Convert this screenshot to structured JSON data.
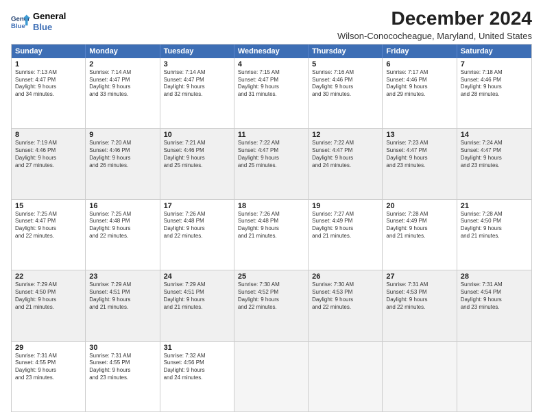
{
  "logo": {
    "line1": "General",
    "line2": "Blue"
  },
  "title": "December 2024",
  "subtitle": "Wilson-Conococheague, Maryland, United States",
  "days": [
    "Sunday",
    "Monday",
    "Tuesday",
    "Wednesday",
    "Thursday",
    "Friday",
    "Saturday"
  ],
  "weeks": [
    [
      {
        "day": "1",
        "info": "Sunrise: 7:13 AM\nSunset: 4:47 PM\nDaylight: 9 hours\nand 34 minutes."
      },
      {
        "day": "2",
        "info": "Sunrise: 7:14 AM\nSunset: 4:47 PM\nDaylight: 9 hours\nand 33 minutes."
      },
      {
        "day": "3",
        "info": "Sunrise: 7:14 AM\nSunset: 4:47 PM\nDaylight: 9 hours\nand 32 minutes."
      },
      {
        "day": "4",
        "info": "Sunrise: 7:15 AM\nSunset: 4:47 PM\nDaylight: 9 hours\nand 31 minutes."
      },
      {
        "day": "5",
        "info": "Sunrise: 7:16 AM\nSunset: 4:46 PM\nDaylight: 9 hours\nand 30 minutes."
      },
      {
        "day": "6",
        "info": "Sunrise: 7:17 AM\nSunset: 4:46 PM\nDaylight: 9 hours\nand 29 minutes."
      },
      {
        "day": "7",
        "info": "Sunrise: 7:18 AM\nSunset: 4:46 PM\nDaylight: 9 hours\nand 28 minutes."
      }
    ],
    [
      {
        "day": "8",
        "info": "Sunrise: 7:19 AM\nSunset: 4:46 PM\nDaylight: 9 hours\nand 27 minutes."
      },
      {
        "day": "9",
        "info": "Sunrise: 7:20 AM\nSunset: 4:46 PM\nDaylight: 9 hours\nand 26 minutes."
      },
      {
        "day": "10",
        "info": "Sunrise: 7:21 AM\nSunset: 4:46 PM\nDaylight: 9 hours\nand 25 minutes."
      },
      {
        "day": "11",
        "info": "Sunrise: 7:22 AM\nSunset: 4:47 PM\nDaylight: 9 hours\nand 25 minutes."
      },
      {
        "day": "12",
        "info": "Sunrise: 7:22 AM\nSunset: 4:47 PM\nDaylight: 9 hours\nand 24 minutes."
      },
      {
        "day": "13",
        "info": "Sunrise: 7:23 AM\nSunset: 4:47 PM\nDaylight: 9 hours\nand 23 minutes."
      },
      {
        "day": "14",
        "info": "Sunrise: 7:24 AM\nSunset: 4:47 PM\nDaylight: 9 hours\nand 23 minutes."
      }
    ],
    [
      {
        "day": "15",
        "info": "Sunrise: 7:25 AM\nSunset: 4:47 PM\nDaylight: 9 hours\nand 22 minutes."
      },
      {
        "day": "16",
        "info": "Sunrise: 7:25 AM\nSunset: 4:48 PM\nDaylight: 9 hours\nand 22 minutes."
      },
      {
        "day": "17",
        "info": "Sunrise: 7:26 AM\nSunset: 4:48 PM\nDaylight: 9 hours\nand 22 minutes."
      },
      {
        "day": "18",
        "info": "Sunrise: 7:26 AM\nSunset: 4:48 PM\nDaylight: 9 hours\nand 21 minutes."
      },
      {
        "day": "19",
        "info": "Sunrise: 7:27 AM\nSunset: 4:49 PM\nDaylight: 9 hours\nand 21 minutes."
      },
      {
        "day": "20",
        "info": "Sunrise: 7:28 AM\nSunset: 4:49 PM\nDaylight: 9 hours\nand 21 minutes."
      },
      {
        "day": "21",
        "info": "Sunrise: 7:28 AM\nSunset: 4:50 PM\nDaylight: 9 hours\nand 21 minutes."
      }
    ],
    [
      {
        "day": "22",
        "info": "Sunrise: 7:29 AM\nSunset: 4:50 PM\nDaylight: 9 hours\nand 21 minutes."
      },
      {
        "day": "23",
        "info": "Sunrise: 7:29 AM\nSunset: 4:51 PM\nDaylight: 9 hours\nand 21 minutes."
      },
      {
        "day": "24",
        "info": "Sunrise: 7:29 AM\nSunset: 4:51 PM\nDaylight: 9 hours\nand 21 minutes."
      },
      {
        "day": "25",
        "info": "Sunrise: 7:30 AM\nSunset: 4:52 PM\nDaylight: 9 hours\nand 22 minutes."
      },
      {
        "day": "26",
        "info": "Sunrise: 7:30 AM\nSunset: 4:53 PM\nDaylight: 9 hours\nand 22 minutes."
      },
      {
        "day": "27",
        "info": "Sunrise: 7:31 AM\nSunset: 4:53 PM\nDaylight: 9 hours\nand 22 minutes."
      },
      {
        "day": "28",
        "info": "Sunrise: 7:31 AM\nSunset: 4:54 PM\nDaylight: 9 hours\nand 23 minutes."
      }
    ],
    [
      {
        "day": "29",
        "info": "Sunrise: 7:31 AM\nSunset: 4:55 PM\nDaylight: 9 hours\nand 23 minutes."
      },
      {
        "day": "30",
        "info": "Sunrise: 7:31 AM\nSunset: 4:55 PM\nDaylight: 9 hours\nand 23 minutes."
      },
      {
        "day": "31",
        "info": "Sunrise: 7:32 AM\nSunset: 4:56 PM\nDaylight: 9 hours\nand 24 minutes."
      },
      {
        "day": "",
        "info": ""
      },
      {
        "day": "",
        "info": ""
      },
      {
        "day": "",
        "info": ""
      },
      {
        "day": "",
        "info": ""
      }
    ]
  ]
}
